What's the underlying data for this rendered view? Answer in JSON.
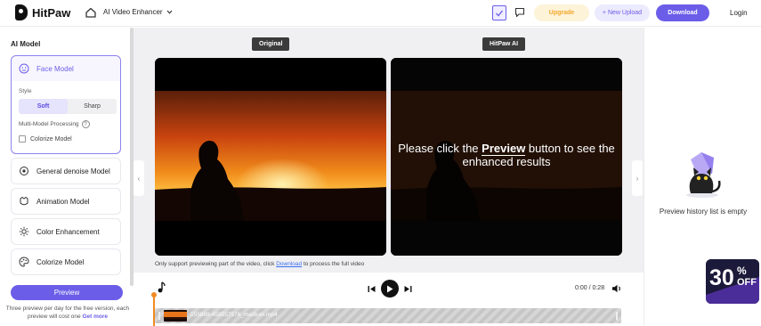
{
  "header": {
    "brand": "HitPaw",
    "product": "AI Video Enhancer",
    "upgrade": "Upgrade",
    "new_upload": "+ New Upload",
    "download": "Download",
    "login": "Login"
  },
  "left_panel": {
    "title": "AI Model",
    "face_model": {
      "label": "Face Model",
      "style_label": "Style",
      "style_options": [
        "Soft",
        "Sharp"
      ],
      "selected_style": "Soft",
      "multi_model_label": "Multi-Model Processing",
      "colorize_label": "Colorize Model",
      "colorize_checked": false
    },
    "models": [
      {
        "label": "General denoise Model",
        "icon": "denoise-icon"
      },
      {
        "label": "Animation Model",
        "icon": "animation-icon"
      },
      {
        "label": "Color Enhancement",
        "icon": "color-icon"
      },
      {
        "label": "Colorize Model",
        "icon": "colorize-icon"
      }
    ],
    "preview_button": "Preview",
    "preview_note": "Three preview per day for the free version, each preview will cost one",
    "get_more": "Get more"
  },
  "center": {
    "tag_original": "Original",
    "tag_ai": "HitPaw AI",
    "msg_pre": "Please click the ",
    "msg_bold": "Preview",
    "msg_post": " button to see the enhanced results",
    "support_pre": "Only support previewing part of the video, click ",
    "support_link": "Download",
    "support_post": " to process the full video"
  },
  "right_panel": {
    "empty_text": "Preview history list is empty",
    "promo_number": "30",
    "promo_pct": "%",
    "promo_off": "OFF"
  },
  "player": {
    "time": "0:00 / 0:28",
    "clip_name": "155888-458557576_medium.mp4"
  },
  "colors": {
    "accent": "#6b5de8",
    "upgrade": "#f4a82b",
    "playhead": "#f08a24"
  }
}
